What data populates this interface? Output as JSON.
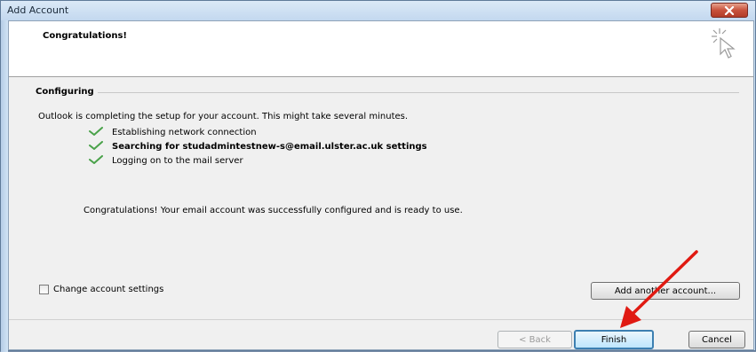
{
  "window": {
    "title": "Add Account"
  },
  "header": {
    "title": "Congratulations!"
  },
  "group": {
    "label": "Configuring"
  },
  "description": "Outlook is completing the setup for your account. This might take several minutes.",
  "tasks": [
    {
      "label": "Establishing network connection",
      "bold": false,
      "status": "done"
    },
    {
      "label": "Searching for studadmintestnew-s@email.ulster.ac.uk settings",
      "bold": true,
      "status": "done"
    },
    {
      "label": "Logging on to the mail server",
      "bold": false,
      "status": "done"
    }
  ],
  "success_message": "Congratulations! Your email account was successfully configured and is ready to use.",
  "change_settings": {
    "label": "Change account settings",
    "checked": false
  },
  "buttons": {
    "add_another": "Add another account...",
    "back": "< Back",
    "finish": "Finish",
    "cancel": "Cancel"
  },
  "colors": {
    "check": "#4aa24a",
    "annotation_arrow": "#e01a12",
    "close_button": "#c8523c"
  }
}
